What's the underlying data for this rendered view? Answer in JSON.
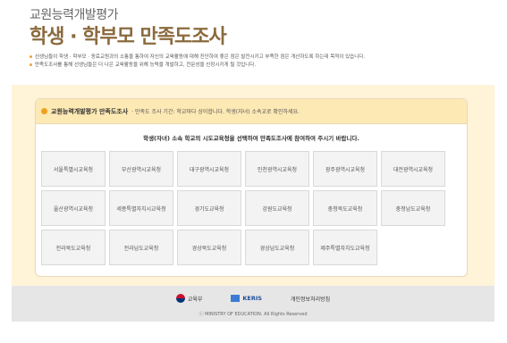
{
  "header": {
    "subtitle": "교원능력개발평가",
    "title": "학생 · 학부모 만족도조사",
    "notes": [
      "선생님들이 학생 · 학부모 · 동료교원과의 소통을 통하여 자신의 교육활동에 대해 진단하여 좋은 점은 발전시키고 부족한 점은 개선하도록 하는데 목적이 있습니다.",
      "만족도조사를 통해 선생님들은 더 나은 교육활동을 위해 능력을 개발하고, 전문성을 신장시키게 될 것입니다."
    ]
  },
  "panel": {
    "title": "교원능력개발평가 만족도조사",
    "description": "· 만족도 조사 기간: 학교마다 상이합니다. 학생(자녀) 소속교로 확인하세요.",
    "instruction": "학생(자녀) 소속 학교의 시도교육청을 선택하여 만족도조사에 참여하여 주시기 바랍니다.",
    "offices": [
      "서울특별시교육청",
      "부산광역시교육청",
      "대구광역시교육청",
      "인천광역시교육청",
      "광주광역시교육청",
      "대전광역시교육청",
      "울산광역시교육청",
      "세종특별자치시교육청",
      "경기도교육청",
      "강원도교육청",
      "충청북도교육청",
      "충청남도교육청",
      "전라북도교육청",
      "전라남도교육청",
      "경상북도교육청",
      "경상남도교육청",
      "제주특별자치도교육청"
    ]
  },
  "footer": {
    "moe": "교육부",
    "keris": "KERIS",
    "privacy": "개인정보처리방침",
    "copyright": "ⓒ MINISTRY OF EDUCATION. All Rights Reserved"
  },
  "colors": {
    "accent": "#8a6a3e",
    "band": "#fff3d8",
    "panel_head": "#fde9b4",
    "bullet": "#f1a23a"
  }
}
